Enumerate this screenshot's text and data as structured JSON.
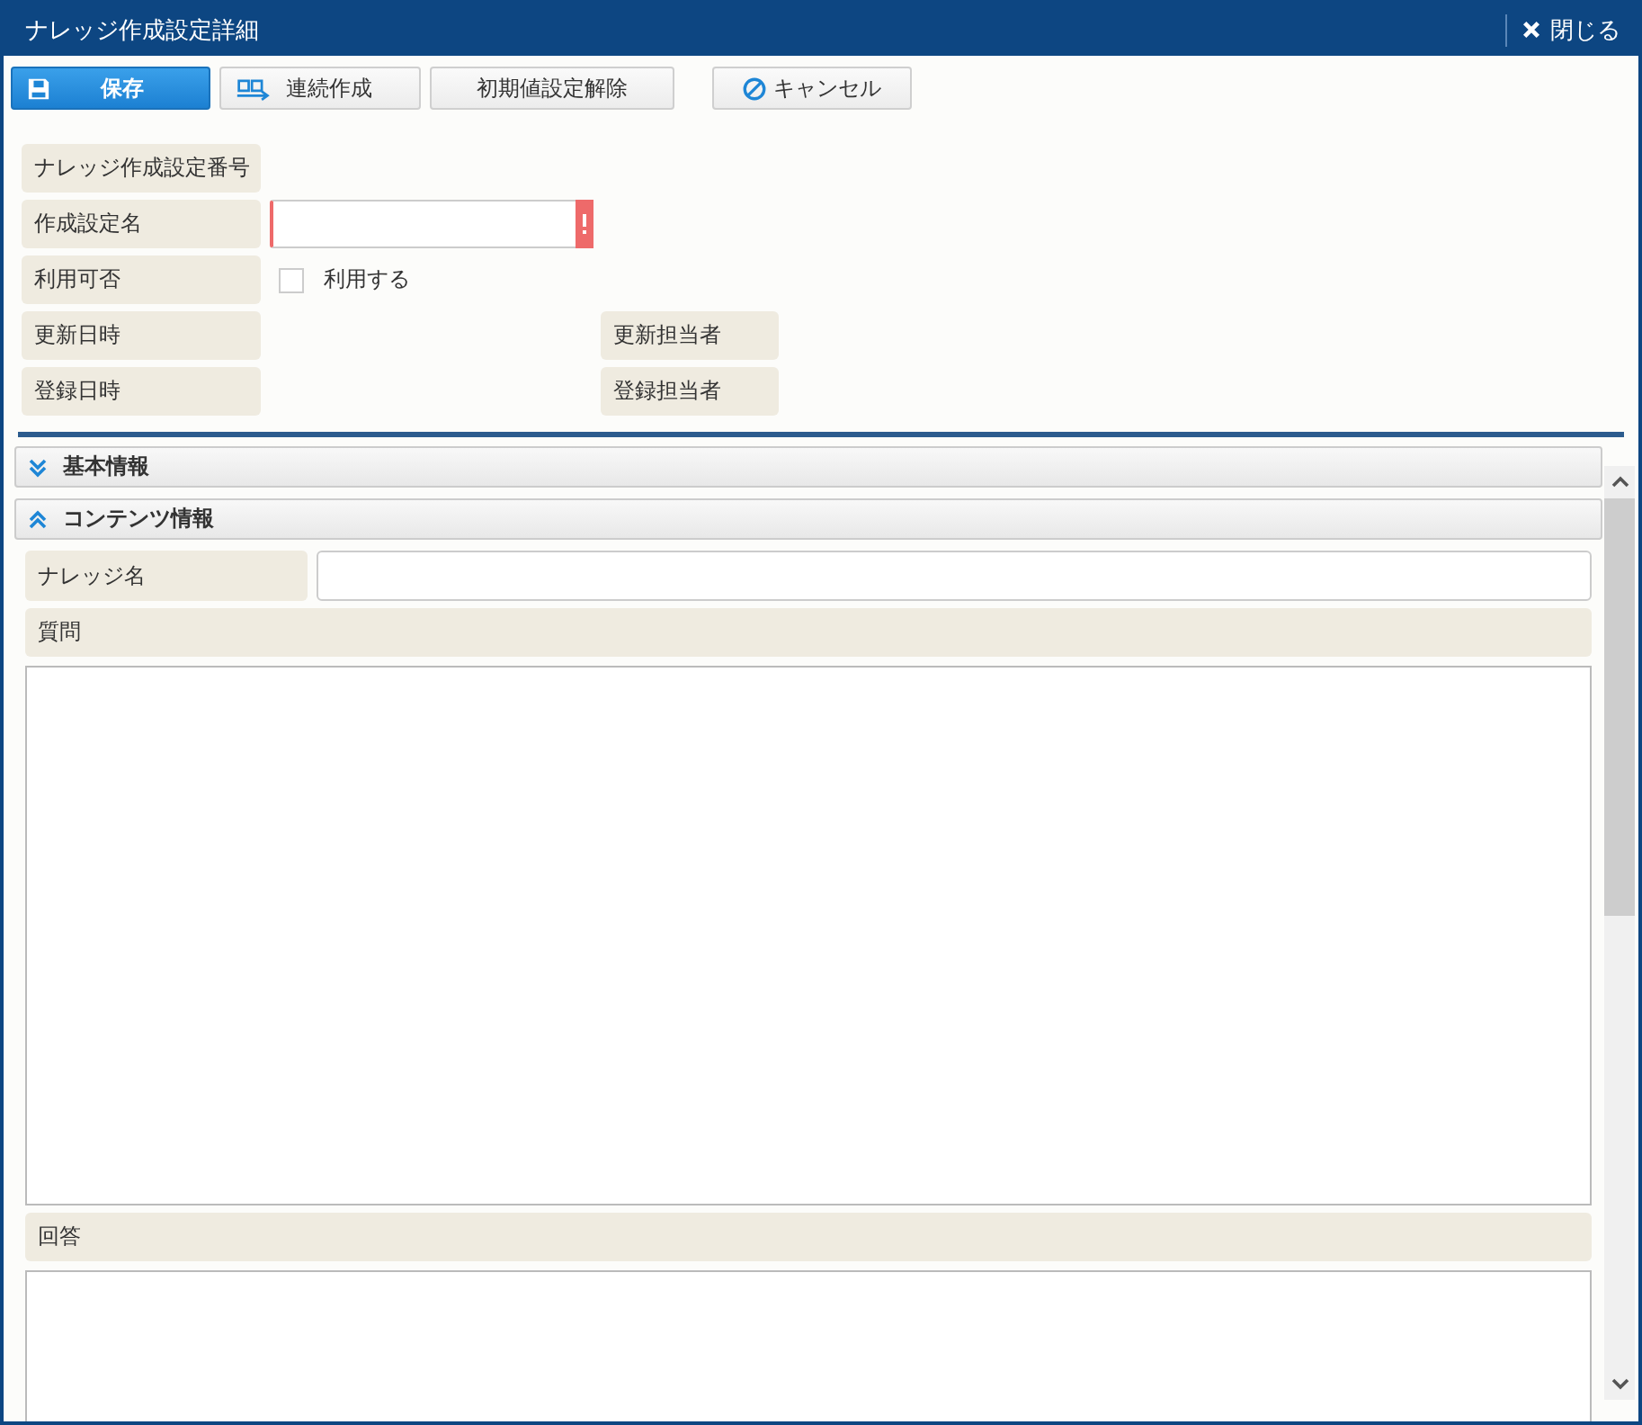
{
  "window": {
    "title": "ナレッジ作成設定詳細",
    "close_label": "閉じる"
  },
  "toolbar": [
    {
      "kind": "save",
      "label": "保存"
    },
    {
      "kind": "continuous",
      "label": "連続作成"
    },
    {
      "kind": "plain",
      "label": "初期値設定解除"
    },
    {
      "kind": "cancel",
      "label": "キャンセル"
    }
  ],
  "form": [
    {
      "kind": "label_only",
      "label": "ナレッジ作成設定番号"
    },
    {
      "kind": "text_input",
      "label": "作成設定名",
      "required": true
    },
    {
      "kind": "checkbox",
      "label": "利用可否",
      "option": "利用する",
      "checked": false
    },
    {
      "kind": "pair",
      "label": "更新日時",
      "right_label": "更新担当者"
    },
    {
      "kind": "pair",
      "label": "登録日時",
      "right_label": "登録担当者"
    }
  ],
  "sections": [
    {
      "title": "基本情報",
      "expanded": false
    },
    {
      "title": "コンテンツ情報",
      "expanded": true
    }
  ],
  "content": {
    "name_label": "ナレッジ名",
    "question_label": "質問",
    "answer_label": "回答"
  }
}
